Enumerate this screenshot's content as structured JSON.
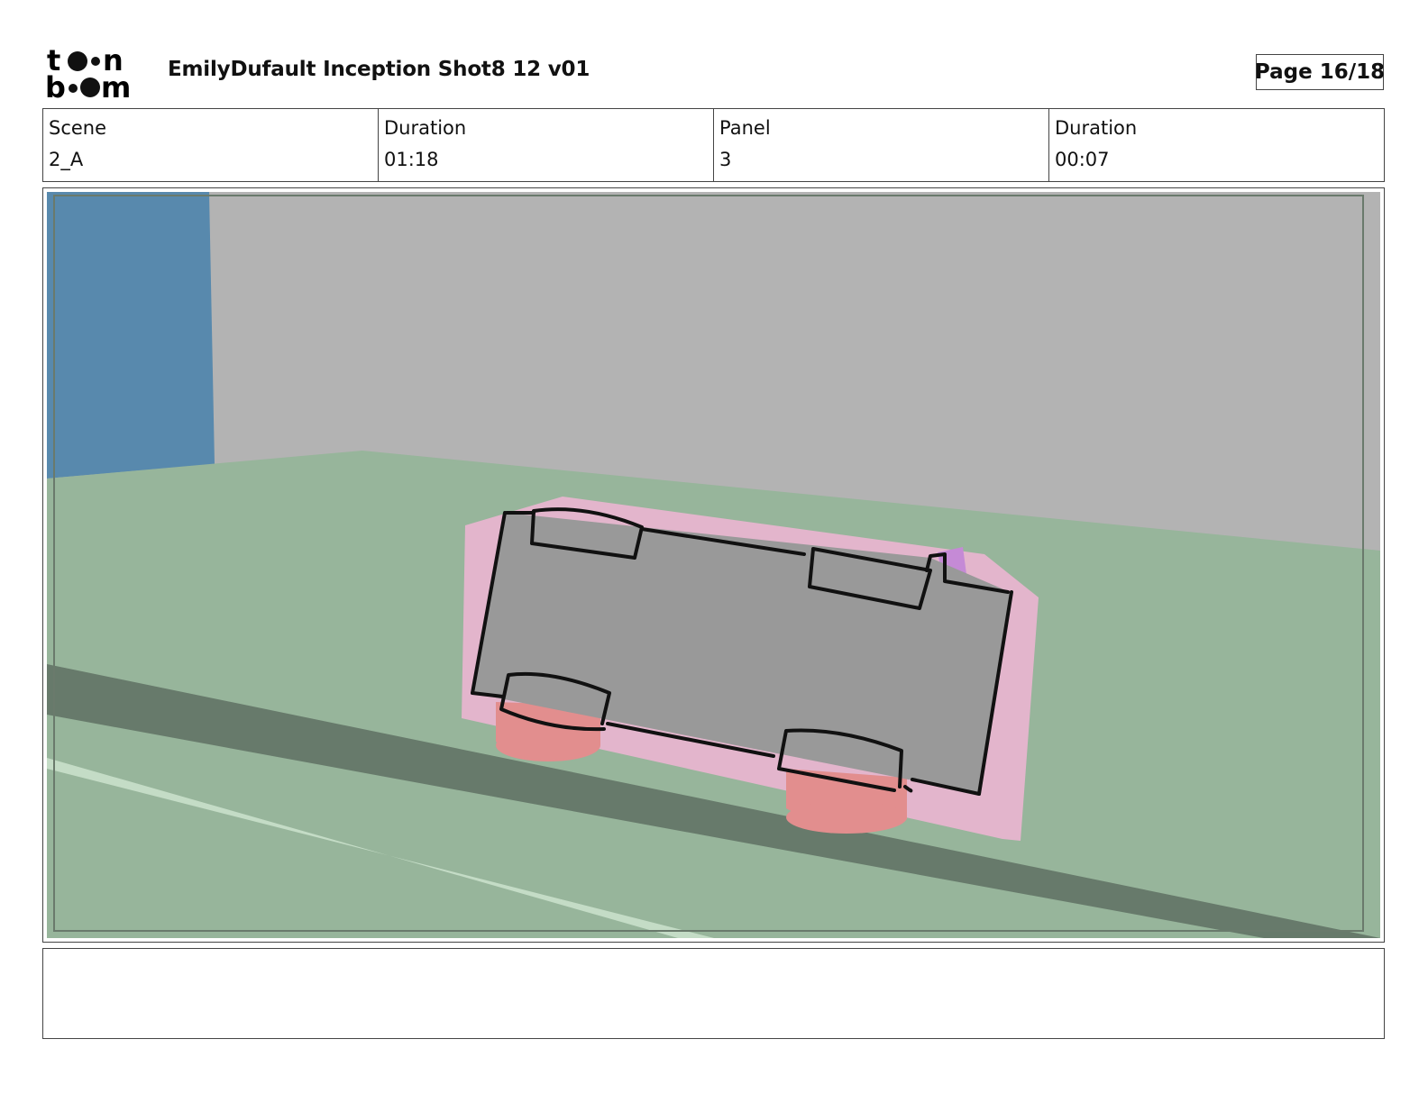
{
  "header": {
    "title": "EmilyDufault Inception Shot8 12 v01",
    "page": "Page 16/18",
    "logo_icon": "toon-boom-logo"
  },
  "info": [
    {
      "label": "Scene",
      "value": "2_A"
    },
    {
      "label": "Duration",
      "value": "01:18"
    },
    {
      "label": "Panel",
      "value": "3"
    },
    {
      "label": "Duration",
      "value": "00:07"
    }
  ],
  "panel": {
    "colors": {
      "wall": "#b3b3b3",
      "blue_wall": "#5889ad",
      "floor": "#97b59b",
      "stripe": "#677a6b",
      "light_line": "#c4dcc6",
      "car_body": "#999999",
      "car_base": "#e3b5cc",
      "wheels": "#e28e8e",
      "outline": "#111111"
    }
  },
  "notes": {
    "text": ""
  }
}
